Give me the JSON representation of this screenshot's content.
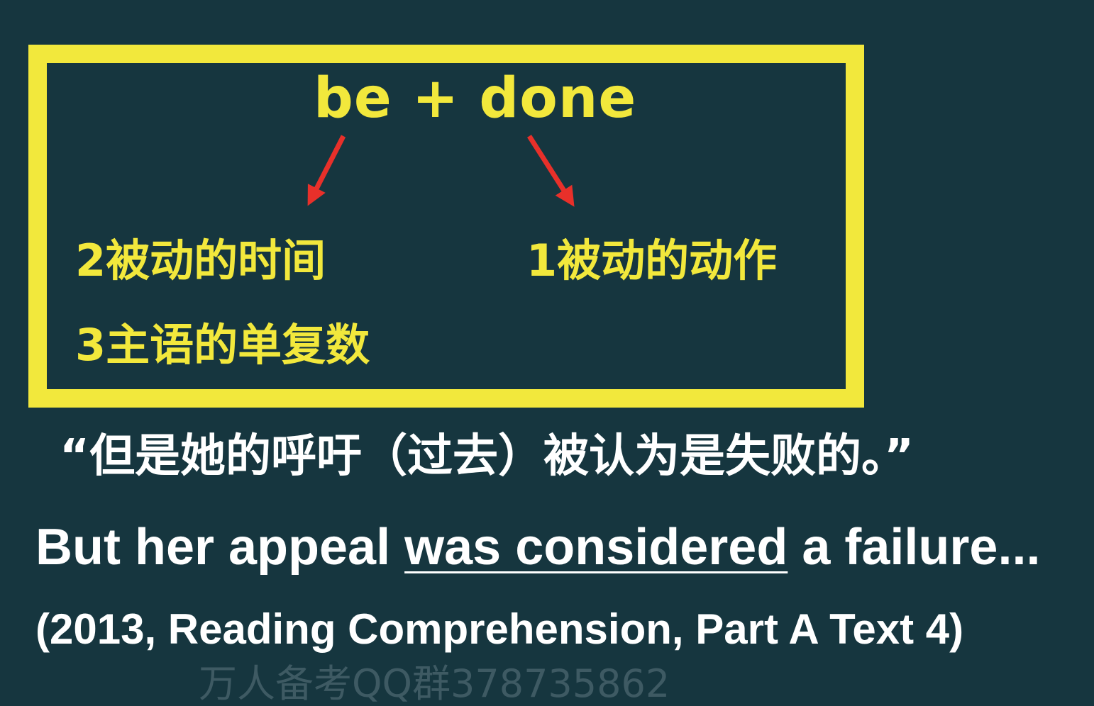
{
  "formula": "be + done",
  "labels": {
    "time": "2被动的时间",
    "action": "1被动的动作",
    "number": "3主语的单复数"
  },
  "chinese_sentence": "“但是她的呼吁（过去）被认为是失败的。”",
  "english_sentence": {
    "before": "But her appeal ",
    "underlined": "was considered",
    "after": " a failure..."
  },
  "source": "(2013, Reading Comprehension, Part A Text 4)",
  "watermark": "万人备考QQ群378735862",
  "colors": {
    "background": "#16363f",
    "accent_yellow": "#f2e83c",
    "arrow_red": "#e8302a",
    "text_white": "#ffffff"
  }
}
